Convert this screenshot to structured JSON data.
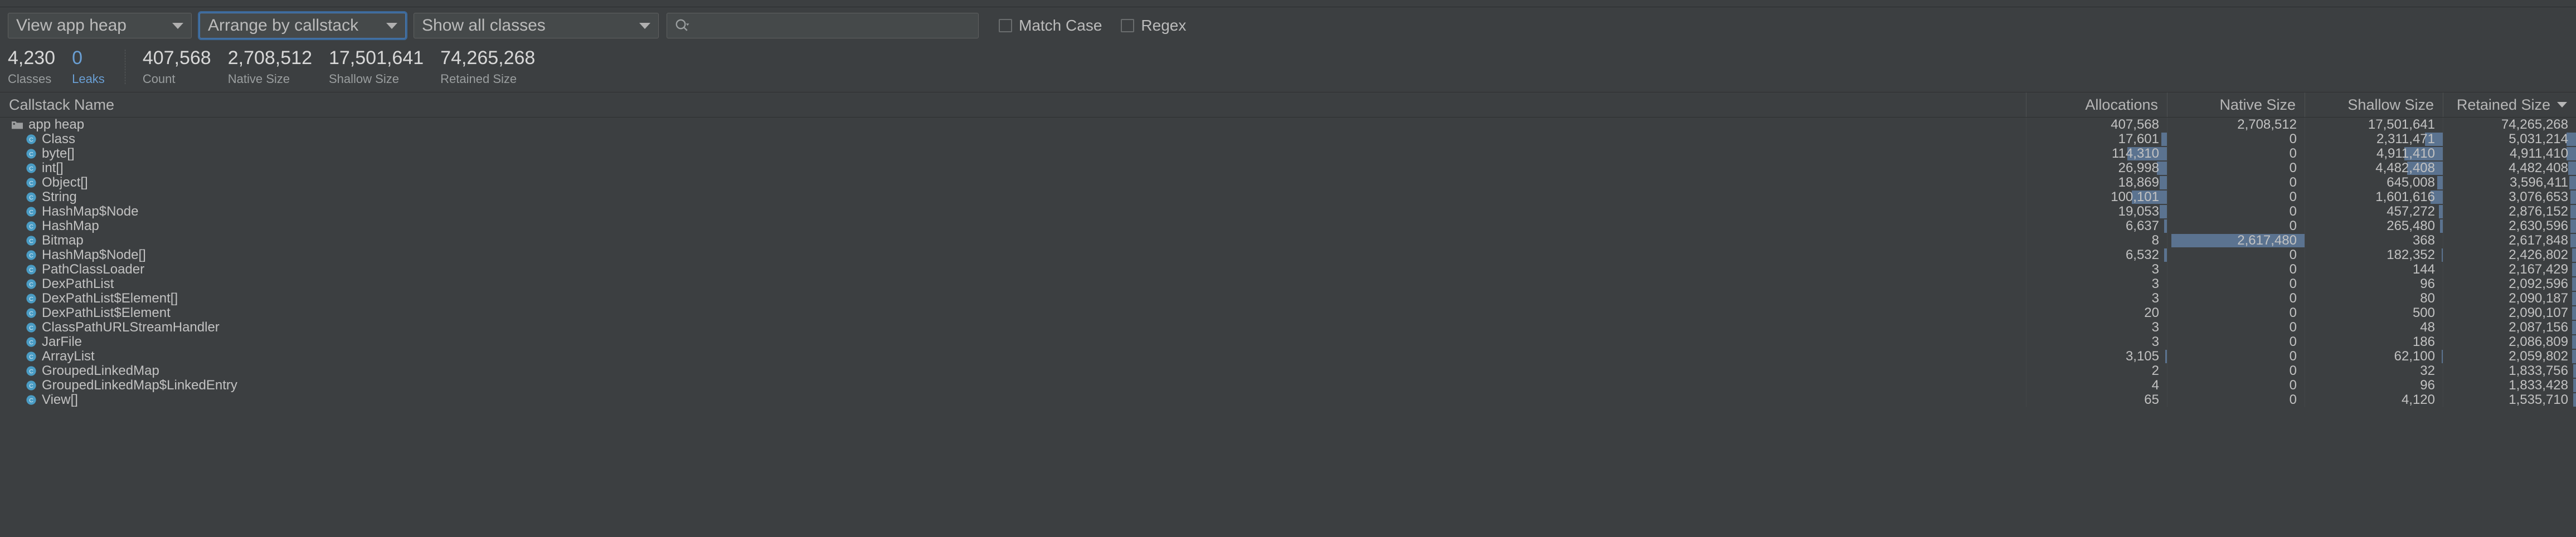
{
  "toolbar": {
    "heap_select": {
      "label": "View app heap",
      "icon": "chevron-down-icon"
    },
    "arrange_select": {
      "label": "Arrange by callstack",
      "icon": "chevron-down-icon"
    },
    "classes_select": {
      "label": "Show all classes",
      "icon": "chevron-down-icon"
    },
    "search": {
      "value": "",
      "placeholder": "",
      "icon": "search-icon"
    },
    "match_case": {
      "label": "Match Case",
      "checked": false
    },
    "regex": {
      "label": "Regex",
      "checked": false
    }
  },
  "stats": [
    {
      "value": "4,230",
      "label": "Classes",
      "accent": false
    },
    {
      "value": "0",
      "label": "Leaks",
      "accent": true
    },
    {
      "value": "407,568",
      "label": "Count",
      "accent": false
    },
    {
      "value": "2,708,512",
      "label": "Native Size",
      "accent": false
    },
    {
      "value": "17,501,641",
      "label": "Shallow Size",
      "accent": false
    },
    {
      "value": "74,265,268",
      "label": "Retained Size",
      "accent": false
    }
  ],
  "table": {
    "columns": [
      {
        "key": "name",
        "label": "Callstack Name",
        "align": "left",
        "sorted": false
      },
      {
        "key": "allocations",
        "label": "Allocations",
        "align": "right",
        "sorted": false
      },
      {
        "key": "native",
        "label": "Native Size",
        "align": "right",
        "sorted": false
      },
      {
        "key": "shallow",
        "label": "Shallow Size",
        "align": "right",
        "sorted": false
      },
      {
        "key": "retained",
        "label": "Retained Size",
        "align": "right",
        "sorted": true,
        "sort_dir": "desc"
      }
    ],
    "sort_indicator": "▼",
    "rows": [
      {
        "name": "app heap",
        "icon": "folder-icon",
        "depth": 0,
        "allocations": "407,568",
        "native": "2,708,512",
        "shallow": "17,501,641",
        "retained": "74,265,268",
        "bars": {
          "allocations": 0,
          "native": 0,
          "shallow": 0,
          "retained": 0
        }
      },
      {
        "name": "Class",
        "icon": "class-icon",
        "depth": 1,
        "allocations": "17,601",
        "native": "0",
        "shallow": "2,311,471",
        "retained": "5,031,214",
        "bars": {
          "allocations": 4,
          "native": 0,
          "shallow": 13,
          "retained": 7
        }
      },
      {
        "name": "byte[]",
        "icon": "class-icon",
        "depth": 1,
        "allocations": "114,310",
        "native": "0",
        "shallow": "4,911,410",
        "retained": "4,911,410",
        "bars": {
          "allocations": 28,
          "native": 0,
          "shallow": 28,
          "retained": 7
        }
      },
      {
        "name": "int[]",
        "icon": "class-icon",
        "depth": 1,
        "allocations": "26,998",
        "native": "0",
        "shallow": "4,482,408",
        "retained": "4,482,408",
        "bars": {
          "allocations": 7,
          "native": 0,
          "shallow": 26,
          "retained": 6
        }
      },
      {
        "name": "Object[]",
        "icon": "class-icon",
        "depth": 1,
        "allocations": "18,869",
        "native": "0",
        "shallow": "645,008",
        "retained": "3,596,411",
        "bars": {
          "allocations": 5,
          "native": 0,
          "shallow": 4,
          "retained": 5
        }
      },
      {
        "name": "String",
        "icon": "class-icon",
        "depth": 1,
        "allocations": "100,101",
        "native": "0",
        "shallow": "1,601,616",
        "retained": "3,076,653",
        "bars": {
          "allocations": 25,
          "native": 0,
          "shallow": 9,
          "retained": 4
        }
      },
      {
        "name": "HashMap$Node",
        "icon": "class-icon",
        "depth": 1,
        "allocations": "19,053",
        "native": "0",
        "shallow": "457,272",
        "retained": "2,876,152",
        "bars": {
          "allocations": 5,
          "native": 0,
          "shallow": 3,
          "retained": 4
        }
      },
      {
        "name": "HashMap",
        "icon": "class-icon",
        "depth": 1,
        "allocations": "6,637",
        "native": "0",
        "shallow": "265,480",
        "retained": "2,630,596",
        "bars": {
          "allocations": 2,
          "native": 0,
          "shallow": 2,
          "retained": 4
        }
      },
      {
        "name": "Bitmap",
        "icon": "class-icon",
        "depth": 1,
        "allocations": "8",
        "native": "2,617,480",
        "shallow": "368",
        "retained": "2,617,848",
        "bars": {
          "allocations": 0,
          "native": 97,
          "shallow": 0,
          "retained": 4
        }
      },
      {
        "name": "HashMap$Node[]",
        "icon": "class-icon",
        "depth": 1,
        "allocations": "6,532",
        "native": "0",
        "shallow": "182,352",
        "retained": "2,426,802",
        "bars": {
          "allocations": 2,
          "native": 0,
          "shallow": 1,
          "retained": 3
        }
      },
      {
        "name": "PathClassLoader",
        "icon": "class-icon",
        "depth": 1,
        "allocations": "3",
        "native": "0",
        "shallow": "144",
        "retained": "2,167,429",
        "bars": {
          "allocations": 0,
          "native": 0,
          "shallow": 0,
          "retained": 3
        }
      },
      {
        "name": "DexPathList",
        "icon": "class-icon",
        "depth": 1,
        "allocations": "3",
        "native": "0",
        "shallow": "96",
        "retained": "2,092,596",
        "bars": {
          "allocations": 0,
          "native": 0,
          "shallow": 0,
          "retained": 3
        }
      },
      {
        "name": "DexPathList$Element[]",
        "icon": "class-icon",
        "depth": 1,
        "allocations": "3",
        "native": "0",
        "shallow": "80",
        "retained": "2,090,187",
        "bars": {
          "allocations": 0,
          "native": 0,
          "shallow": 0,
          "retained": 3
        }
      },
      {
        "name": "DexPathList$Element",
        "icon": "class-icon",
        "depth": 1,
        "allocations": "20",
        "native": "0",
        "shallow": "500",
        "retained": "2,090,107",
        "bars": {
          "allocations": 0,
          "native": 0,
          "shallow": 0,
          "retained": 3
        }
      },
      {
        "name": "ClassPathURLStreamHandler",
        "icon": "class-icon",
        "depth": 1,
        "allocations": "3",
        "native": "0",
        "shallow": "48",
        "retained": "2,087,156",
        "bars": {
          "allocations": 0,
          "native": 0,
          "shallow": 0,
          "retained": 3
        }
      },
      {
        "name": "JarFile",
        "icon": "class-icon",
        "depth": 1,
        "allocations": "3",
        "native": "0",
        "shallow": "186",
        "retained": "2,086,809",
        "bars": {
          "allocations": 0,
          "native": 0,
          "shallow": 0,
          "retained": 3
        }
      },
      {
        "name": "ArrayList",
        "icon": "class-icon",
        "depth": 1,
        "allocations": "3,105",
        "native": "0",
        "shallow": "62,100",
        "retained": "2,059,802",
        "bars": {
          "allocations": 1,
          "native": 0,
          "shallow": 1,
          "retained": 3
        }
      },
      {
        "name": "GroupedLinkedMap",
        "icon": "class-icon",
        "depth": 1,
        "allocations": "2",
        "native": "0",
        "shallow": "32",
        "retained": "1,833,756",
        "bars": {
          "allocations": 0,
          "native": 0,
          "shallow": 0,
          "retained": 2
        }
      },
      {
        "name": "GroupedLinkedMap$LinkedEntry",
        "icon": "class-icon",
        "depth": 1,
        "allocations": "4",
        "native": "0",
        "shallow": "96",
        "retained": "1,833,428",
        "bars": {
          "allocations": 0,
          "native": 0,
          "shallow": 0,
          "retained": 2
        }
      },
      {
        "name": "View[]",
        "icon": "class-icon",
        "depth": 1,
        "allocations": "65",
        "native": "0",
        "shallow": "4,120",
        "retained": "1,535,710",
        "bars": {
          "allocations": 0,
          "native": 0,
          "shallow": 0,
          "retained": 2
        }
      }
    ]
  },
  "colors": {
    "background": "#3c3f41",
    "bar": "#5b7390",
    "accent_blue": "#6a9fd4",
    "class_icon": "#4a9cc4",
    "focus_ring": "#4b7cb5",
    "text": "#c2c2c2"
  }
}
